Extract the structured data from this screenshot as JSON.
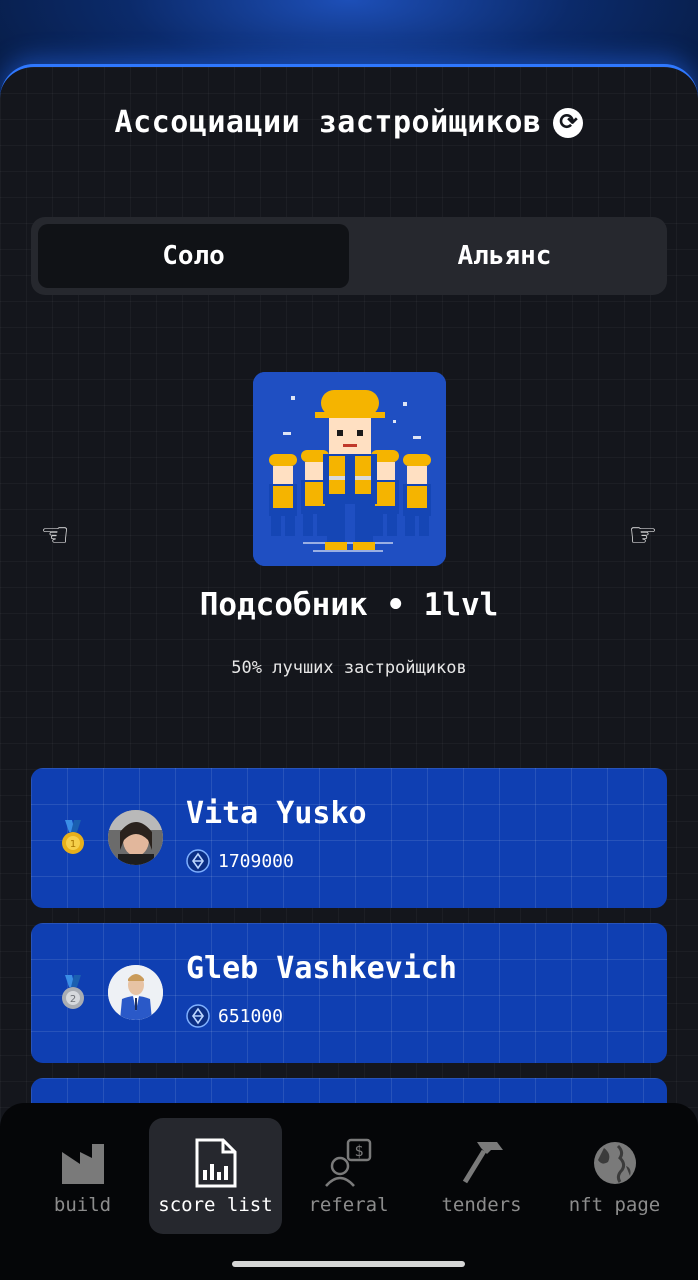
{
  "header": {
    "title": "Ассоциации застройщиков",
    "refresh_icon": "refresh-icon"
  },
  "tabs": [
    {
      "label": "Соло",
      "active": true
    },
    {
      "label": "Альянс",
      "active": false
    }
  ],
  "rank": {
    "name": "Подсобник • 1lvl",
    "subtitle": "50% лучших застройщиков",
    "prev_icon": "pointing-left-hand-icon",
    "next_icon": "pointing-right-hand-icon"
  },
  "leaderboard": [
    {
      "place": 1,
      "medal": "gold-medal-icon",
      "name": "Vita Yusko",
      "score": "1709000"
    },
    {
      "place": 2,
      "medal": "silver-medal-icon",
      "name": "Gleb Vashkevich",
      "score": "651000"
    }
  ],
  "nav": [
    {
      "label": "build",
      "icon": "building-icon",
      "active": false
    },
    {
      "label": "score list",
      "icon": "document-chart-icon",
      "active": true
    },
    {
      "label": "referal",
      "icon": "referral-icon",
      "active": false
    },
    {
      "label": "tenders",
      "icon": "hammer-icon",
      "active": false
    },
    {
      "label": "nft page",
      "icon": "globe-icon",
      "active": false
    }
  ],
  "colors": {
    "accent": "#2f78ff",
    "card": "#0f3fb2",
    "panel": "#14161c"
  }
}
